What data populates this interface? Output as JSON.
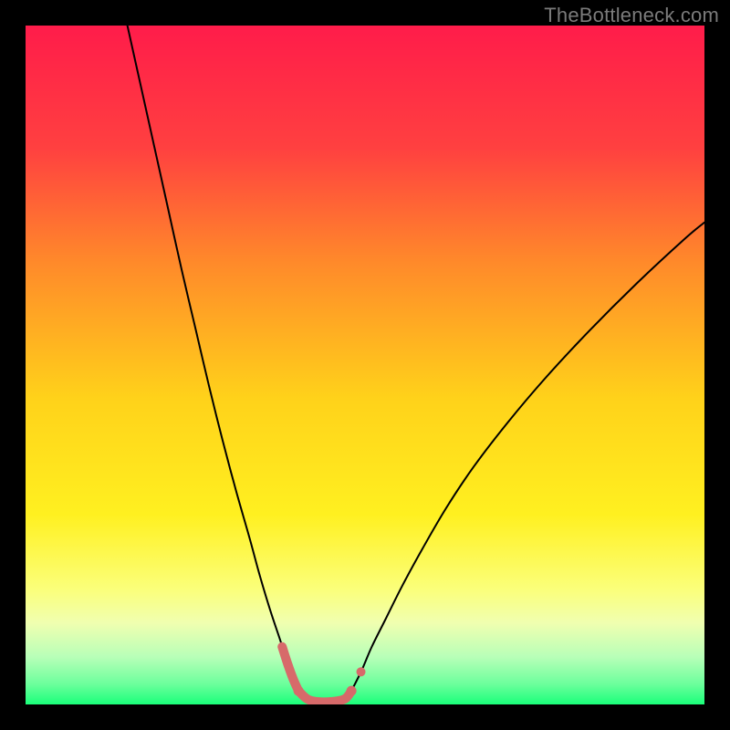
{
  "watermark": "TheBottleneck.com",
  "chart_data": {
    "type": "line",
    "title": "",
    "xlabel": "",
    "ylabel": "",
    "xlim": [
      0,
      100
    ],
    "ylim": [
      0,
      100
    ],
    "background_gradient": {
      "stops": [
        {
          "offset": 0.0,
          "color": "#ff1c4a"
        },
        {
          "offset": 0.18,
          "color": "#ff4040"
        },
        {
          "offset": 0.35,
          "color": "#ff8a2a"
        },
        {
          "offset": 0.55,
          "color": "#ffd21a"
        },
        {
          "offset": 0.72,
          "color": "#fff020"
        },
        {
          "offset": 0.83,
          "color": "#fbff7a"
        },
        {
          "offset": 0.88,
          "color": "#f0ffb0"
        },
        {
          "offset": 0.93,
          "color": "#b8ffb8"
        },
        {
          "offset": 0.97,
          "color": "#6cff9c"
        },
        {
          "offset": 1.0,
          "color": "#1aff7a"
        }
      ]
    },
    "series": [
      {
        "name": "curve-left",
        "color": "#000000",
        "width": 2,
        "x": [
          15.0,
          17.0,
          19.0,
          21.0,
          23.0,
          25.0,
          27.0,
          29.0,
          31.0,
          33.0,
          34.5,
          36.0,
          37.5,
          39.0,
          40.2
        ],
        "y": [
          100.0,
          91.0,
          82.0,
          73.0,
          64.0,
          55.5,
          47.0,
          39.0,
          31.5,
          24.5,
          19.0,
          14.0,
          9.5,
          5.0,
          2.0
        ]
      },
      {
        "name": "curve-right",
        "color": "#000000",
        "width": 2,
        "x": [
          48.0,
          49.5,
          51.0,
          53.0,
          55.5,
          58.5,
          62.0,
          66.0,
          71.0,
          76.5,
          83.0,
          90.0,
          97.0,
          100.0
        ],
        "y": [
          2.0,
          5.0,
          8.5,
          12.5,
          17.5,
          23.0,
          29.0,
          35.0,
          41.5,
          48.0,
          55.0,
          62.0,
          68.5,
          71.0
        ]
      },
      {
        "name": "valley-floor",
        "color": "#d76a6a",
        "style": "thick-with-dots",
        "width": 10,
        "x": [
          40.2,
          41.5,
          43.0,
          45.0,
          47.0,
          48.0
        ],
        "y": [
          2.0,
          0.8,
          0.4,
          0.4,
          0.8,
          2.0
        ]
      },
      {
        "name": "valley-wall-left",
        "color": "#d76a6a",
        "style": "thick",
        "width": 10,
        "x": [
          37.8,
          38.6,
          39.4,
          40.2
        ],
        "y": [
          8.5,
          6.0,
          3.8,
          2.0
        ]
      },
      {
        "name": "valley-dot-right",
        "color": "#d76a6a",
        "style": "dot",
        "radius": 5,
        "x": [
          49.4
        ],
        "y": [
          4.8
        ]
      }
    ]
  }
}
